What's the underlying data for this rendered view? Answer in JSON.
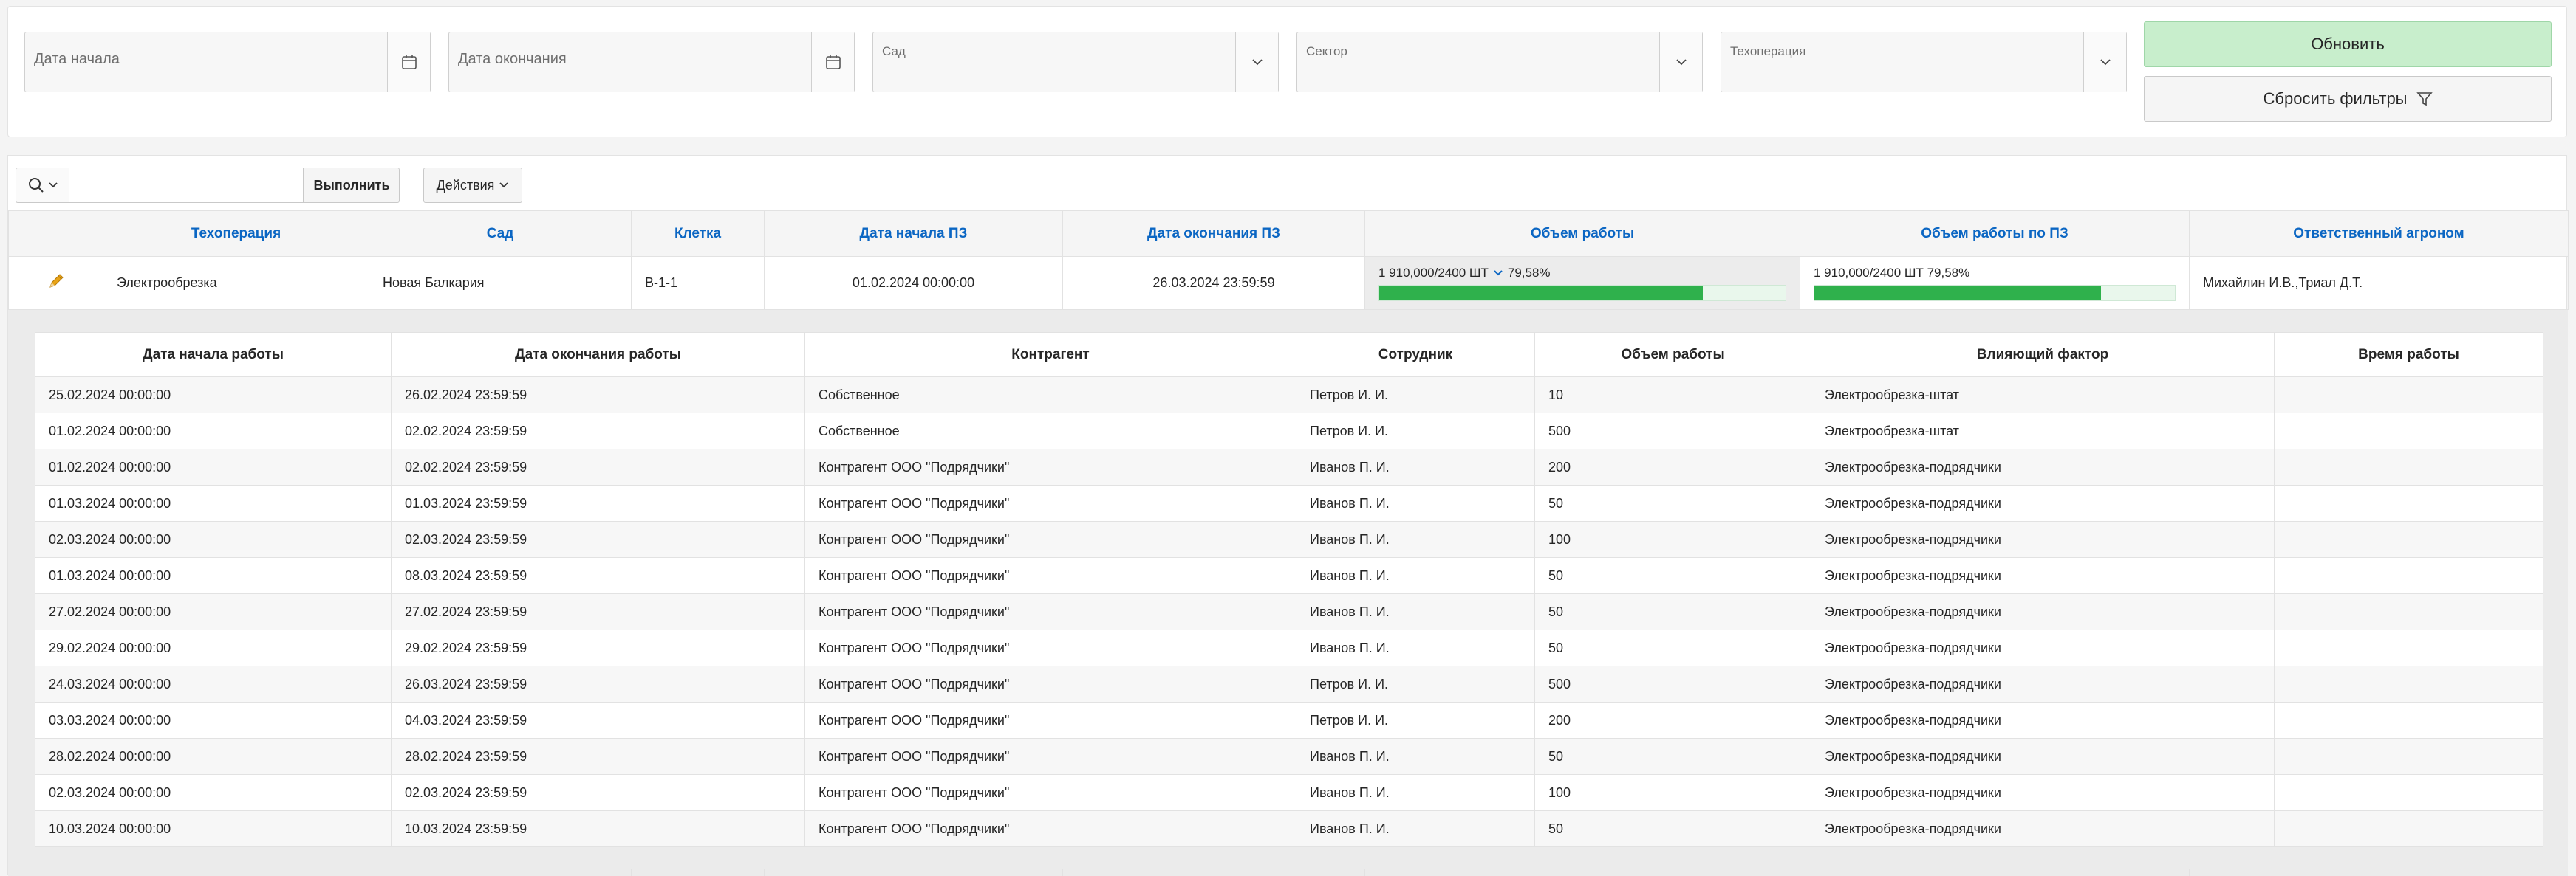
{
  "filters": {
    "start_date_placeholder": "Дата начала",
    "end_date_placeholder": "Дата окончания",
    "garden_label": "Сад",
    "sector_label": "Сектор",
    "operation_label": "Техоперация",
    "refresh_label": "Обновить",
    "reset_label": "Сбросить фильтры"
  },
  "toolbar": {
    "search_value": "",
    "go_label": "Выполнить",
    "actions_label": "Действия"
  },
  "master": {
    "headers": [
      "Техоперация",
      "Сад",
      "Клетка",
      "Дата начала ПЗ",
      "Дата окончания ПЗ",
      "Объем работы",
      "Объем работы по ПЗ",
      "Ответственный агроном"
    ],
    "row": {
      "operation": "Электрообрезка",
      "garden": "Новая Балкария",
      "cell": "В-1-1",
      "start": "01.02.2024 00:00:00",
      "end": "26.03.2024 23:59:59",
      "volume_text": "1 910,000/2400 ШТ",
      "volume_percent_text": "79,58%",
      "volume_fraction": 0.7958,
      "volume_pz_text": "1 910,000/2400 ШТ 79,58%",
      "volume_pz_fraction": 0.7958,
      "agronomist": "Михайлин И.В.,Триал Д.Т."
    }
  },
  "detail": {
    "headers": [
      "Дата начала работы",
      "Дата окончания работы",
      "Контрагент",
      "Сотрудник",
      "Объем работы",
      "Влияющий фактор",
      "Время работы"
    ],
    "rows": [
      [
        "25.02.2024 00:00:00",
        "26.02.2024 23:59:59",
        "Собственное",
        "Петров И. И.",
        "10",
        "Электрообрезка-штат",
        ""
      ],
      [
        "01.02.2024 00:00:00",
        "02.02.2024 23:59:59",
        "Собственное",
        "Петров И. И.",
        "500",
        "Электрообрезка-штат",
        ""
      ],
      [
        "01.02.2024 00:00:00",
        "02.02.2024 23:59:59",
        "Контрагент ООО \"Подрядчики\"",
        "Иванов П. И.",
        "200",
        "Электрообрезка-подрядчики",
        ""
      ],
      [
        "01.03.2024 00:00:00",
        "01.03.2024 23:59:59",
        "Контрагент ООО \"Подрядчики\"",
        "Иванов П. И.",
        "50",
        "Электрообрезка-подрядчики",
        ""
      ],
      [
        "02.03.2024 00:00:00",
        "02.03.2024 23:59:59",
        "Контрагент ООО \"Подрядчики\"",
        "Иванов П. И.",
        "100",
        "Электрообрезка-подрядчики",
        ""
      ],
      [
        "01.03.2024 00:00:00",
        "08.03.2024 23:59:59",
        "Контрагент ООО \"Подрядчики\"",
        "Иванов П. И.",
        "50",
        "Электрообрезка-подрядчики",
        ""
      ],
      [
        "27.02.2024 00:00:00",
        "27.02.2024 23:59:59",
        "Контрагент ООО \"Подрядчики\"",
        "Иванов П. И.",
        "50",
        "Электрообрезка-подрядчики",
        ""
      ],
      [
        "29.02.2024 00:00:00",
        "29.02.2024 23:59:59",
        "Контрагент ООО \"Подрядчики\"",
        "Иванов П. И.",
        "50",
        "Электрообрезка-подрядчики",
        ""
      ],
      [
        "24.03.2024 00:00:00",
        "26.03.2024 23:59:59",
        "Контрагент ООО \"Подрядчики\"",
        "Петров И. И.",
        "500",
        "Электрообрезка-подрядчики",
        ""
      ],
      [
        "03.03.2024 00:00:00",
        "04.03.2024 23:59:59",
        "Контрагент ООО \"Подрядчики\"",
        "Петров И. И.",
        "200",
        "Электрообрезка-подрядчики",
        ""
      ],
      [
        "28.02.2024 00:00:00",
        "28.02.2024 23:59:59",
        "Контрагент ООО \"Подрядчики\"",
        "Иванов П. И.",
        "50",
        "Электрообрезка-подрядчики",
        ""
      ],
      [
        "02.03.2024 00:00:00",
        "02.03.2024 23:59:59",
        "Контрагент ООО \"Подрядчики\"",
        "Иванов П. И.",
        "100",
        "Электрообрезка-подрядчики",
        ""
      ],
      [
        "10.03.2024 00:00:00",
        "10.03.2024 23:59:59",
        "Контрагент ООО \"Подрядчики\"",
        "Иванов П. И.",
        "50",
        "Электрообрезка-подрядчики",
        ""
      ]
    ]
  },
  "icons": {
    "calendar": "calendar-icon",
    "chevron": "chevron-down-icon",
    "search": "search-icon",
    "filter": "filter-icon",
    "edit": "pencil-icon"
  },
  "colors": {
    "accent_link": "#0b66c3",
    "refresh_bg": "#c8eecc",
    "progress": "#2fb14c",
    "pencil": "#e8a317"
  }
}
